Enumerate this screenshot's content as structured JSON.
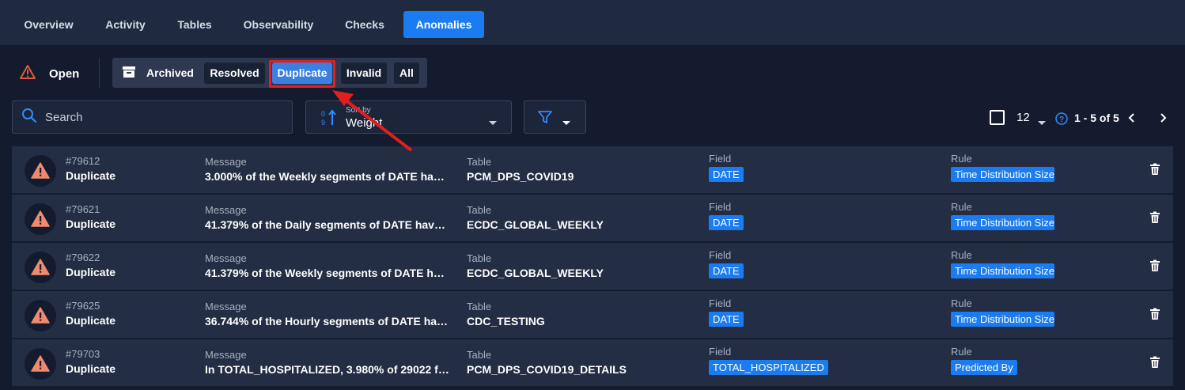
{
  "tabs": [
    {
      "label": "Overview",
      "active": false
    },
    {
      "label": "Activity",
      "active": false
    },
    {
      "label": "Tables",
      "active": false
    },
    {
      "label": "Observability",
      "active": false
    },
    {
      "label": "Checks",
      "active": false
    },
    {
      "label": "Anomalies",
      "active": true
    }
  ],
  "status": {
    "open_label": "Open",
    "open_icon": "warning-triangle-icon",
    "archived_label": "Archived",
    "archive_icon": "archive-box-icon",
    "resolved_label": "Resolved",
    "duplicate_label": "Duplicate",
    "invalid_label": "Invalid",
    "all_label": "All",
    "selected": "Duplicate"
  },
  "toolbar": {
    "search_placeholder": "Search",
    "sort_caption": "Sort by",
    "sort_value": "Weight",
    "page_size": "12",
    "range_text": "1 - 5 of 5"
  },
  "column_labels": {
    "message": "Message",
    "table": "Table",
    "field": "Field",
    "rule": "Rule"
  },
  "anomalies": [
    {
      "id": "#79612",
      "status": "Duplicate",
      "message": "3.000% of the Weekly segments of DATE have...",
      "table": "PCM_DPS_COVID19",
      "field": "DATE",
      "rule": "Time Distribution Size"
    },
    {
      "id": "#79621",
      "status": "Duplicate",
      "message": "41.379% of the Daily segments of DATE have r...",
      "table": "ECDC_GLOBAL_WEEKLY",
      "field": "DATE",
      "rule": "Time Distribution Size"
    },
    {
      "id": "#79622",
      "status": "Duplicate",
      "message": "41.379% of the Weekly segments of DATE hav...",
      "table": "ECDC_GLOBAL_WEEKLY",
      "field": "DATE",
      "rule": "Time Distribution Size"
    },
    {
      "id": "#79625",
      "status": "Duplicate",
      "message": "36.744% of the Hourly segments of DATE have...",
      "table": "CDC_TESTING",
      "field": "DATE",
      "rule": "Time Distribution Size"
    },
    {
      "id": "#79703",
      "status": "Duplicate",
      "message": "In TOTAL_HOSPITALIZED, 3.980% of 29022 fil...",
      "table": "PCM_DPS_COVID19_DETAILS",
      "field": "TOTAL_HOSPITALIZED",
      "rule": "Predicted By"
    }
  ],
  "colors": {
    "accent": "#1a7cf0",
    "warning": "#f08a6c",
    "highlight": "#e02020"
  }
}
